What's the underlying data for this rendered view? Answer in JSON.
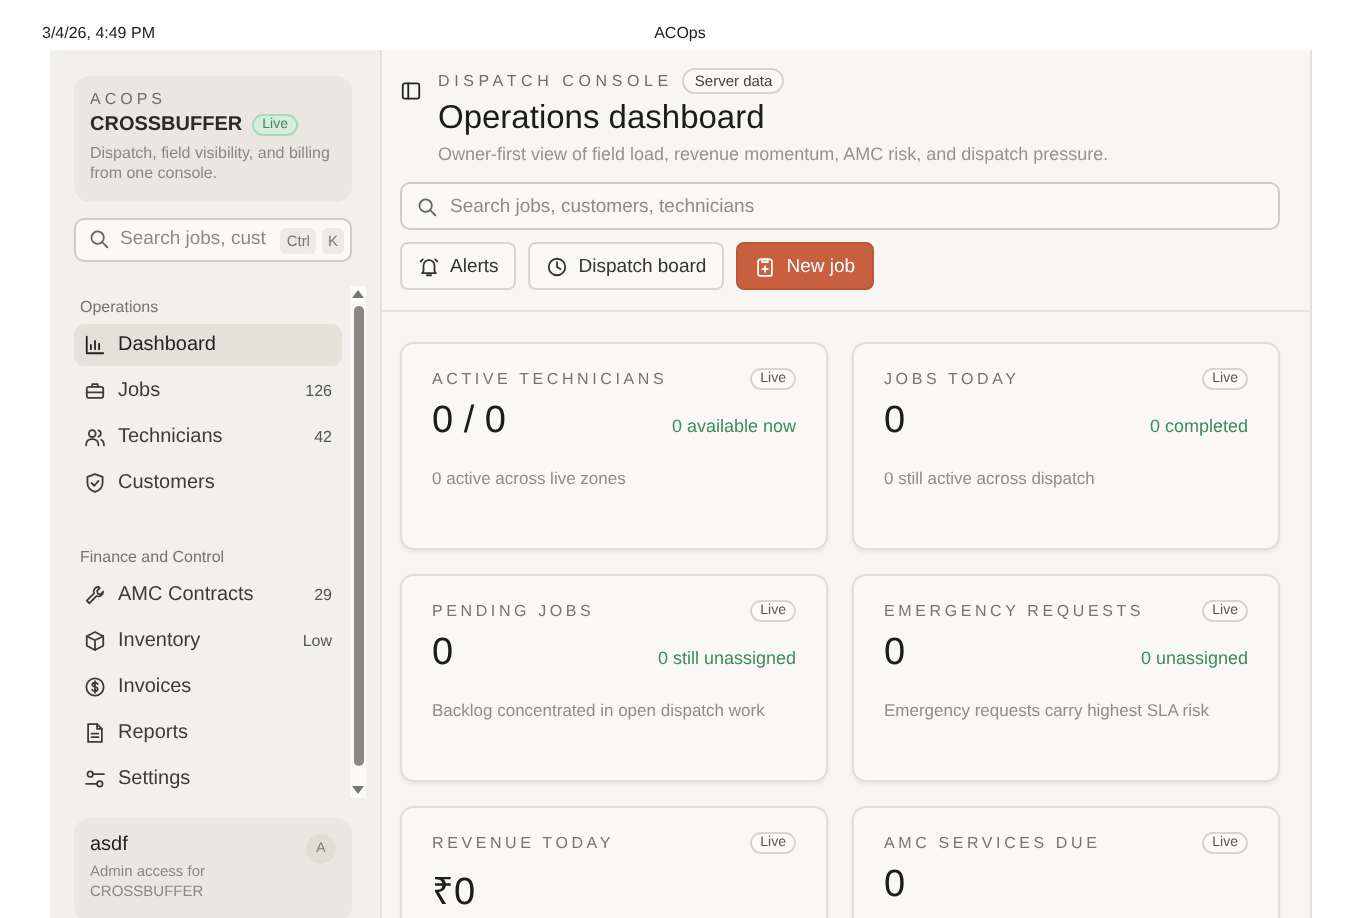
{
  "page_header": {
    "timestamp": "3/4/26, 4:49 PM",
    "title": "ACOps"
  },
  "sidebar": {
    "brand": {
      "eyebrow": "ACOPS",
      "name": "CROSSBUFFER",
      "badge": "Live",
      "description": "Dispatch, field visibility, and billing from one console."
    },
    "search": {
      "placeholder": "Search jobs, cust",
      "keys": [
        "Ctrl",
        "K"
      ]
    },
    "sections": [
      {
        "title": "Operations",
        "items": [
          {
            "label": "Dashboard",
            "selected": true
          },
          {
            "label": "Jobs",
            "count": "126",
            "selected": false
          },
          {
            "label": "Technicians",
            "count": "42",
            "selected": false
          },
          {
            "label": "Customers",
            "selected": false
          }
        ]
      },
      {
        "title": "Finance and Control",
        "items": [
          {
            "label": "AMC Contracts",
            "count": "29",
            "selected": false
          },
          {
            "label": "Inventory",
            "count": "Low",
            "selected": false
          },
          {
            "label": "Invoices",
            "selected": false
          },
          {
            "label": "Reports",
            "selected": false
          },
          {
            "label": "Settings",
            "selected": false
          }
        ]
      }
    ],
    "user": {
      "name": "asdf",
      "role": "Admin access for CROSSBUFFER",
      "initial": "A"
    }
  },
  "main": {
    "eyebrow": "DISPATCH CONSOLE",
    "badge": "Server data",
    "title": "Operations dashboard",
    "subtitle": "Owner-first view of field load, revenue momentum, AMC risk, and dispatch pressure.",
    "search": {
      "placeholder": "Search jobs, customers, technicians"
    },
    "buttons": [
      {
        "label": "Alerts",
        "kind": "secondary"
      },
      {
        "label": "Dispatch board",
        "kind": "secondary"
      },
      {
        "label": "New job",
        "kind": "primary"
      }
    ],
    "cards": [
      {
        "title": "ACTIVE TECHNICIANS",
        "badge": "Live",
        "value": "0 / 0",
        "note": "0 available now",
        "detail": "0 active across live zones"
      },
      {
        "title": "JOBS TODAY",
        "badge": "Live",
        "value": "0",
        "note": "0 completed",
        "detail": "0 still active across dispatch"
      },
      {
        "title": "PENDING JOBS",
        "badge": "Live",
        "value": "0",
        "note": "0 still unassigned",
        "detail": "Backlog concentrated in open dispatch work"
      },
      {
        "title": "EMERGENCY REQUESTS",
        "badge": "Live",
        "value": "0",
        "note": "0 unassigned",
        "detail": "Emergency requests carry highest SLA risk"
      },
      {
        "title": "REVENUE TODAY",
        "badge": "Live",
        "value": "₹0"
      },
      {
        "title": "AMC SERVICES DUE",
        "badge": "Live",
        "value": "0"
      }
    ]
  }
}
